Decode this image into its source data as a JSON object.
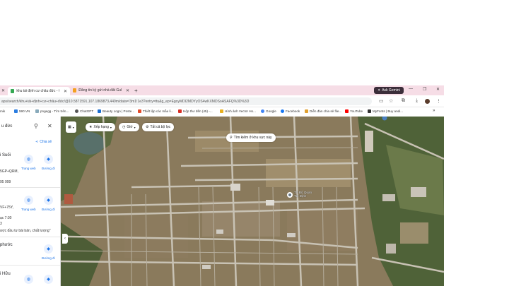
{
  "tabs": [
    {
      "label": "khu tái định cư châu đức - Goo",
      "active": true
    },
    {
      "label": "Đăng tin ký gửi nhà đất Guland",
      "active": false
    }
  ],
  "new_tab": "+",
  "ask_gemini": "Ask Gemini",
  "window": {
    "minimize": "—",
    "restore": "❐",
    "close": "✕"
  },
  "address": {
    "url": "aps/search/khu+tái+định+cư+châu+đức/@10.5871591,107.1869873,449m/data=!3m1!1e3?entry=ttu&g_ep=EgoyMDI2MDYyOS4wKXMDSoASAFQ%3D%3D"
  },
  "bookmarks": [
    {
      "label": "mik"
    },
    {
      "label": "590.VN"
    },
    {
      "label": "pngegg - Tìm trên..."
    },
    {
      "label": "ChatGPT"
    },
    {
      "label": "Beauty Logo | Poste..."
    },
    {
      "label": "Thiết lập các mẫu li..."
    },
    {
      "label": "Hộp thư đến (45) -..."
    },
    {
      "label": "Hình ảnh Vector Ho..."
    },
    {
      "label": "Google"
    },
    {
      "label": "Facebook"
    },
    {
      "label": "Diễn đàn chia sẻ file..."
    },
    {
      "label": "YouTube"
    },
    {
      "label": "MyFonts | Buy andi..."
    },
    {
      "label": "»"
    }
  ],
  "left_panel": {
    "search_value": "u đức",
    "share": "Chia sẻ",
    "results": [
      {
        "title": "i Suối",
        "lines": [
          "5GP+QRM,",
          "95 999"
        ]
      },
      {
        "title": "",
        "lines": [
          "VF+75Y,",
          "ạc 7:30",
          "3",
          "ược đầu tư bài bản, chất lượng\""
        ]
      },
      {
        "title": "phước",
        "lines": []
      },
      {
        "title": "i Hữu",
        "lines": []
      }
    ],
    "website_label": "Trang web",
    "directions_label": "Đường đi"
  },
  "map": {
    "chips": [
      {
        "label": "Xếp hạng"
      },
      {
        "label": "Giờ"
      },
      {
        "label": "Tất cả bộ lọc"
      }
    ],
    "search_area": "Tìm kiếm ở khu vực này",
    "pin_label": [
      "Trí Độ Quan",
      "Tái Định"
    ]
  },
  "colors": {
    "tabbar": "#f6dde6",
    "gemini": "#3c2e3a",
    "link": "#1a73e8"
  }
}
